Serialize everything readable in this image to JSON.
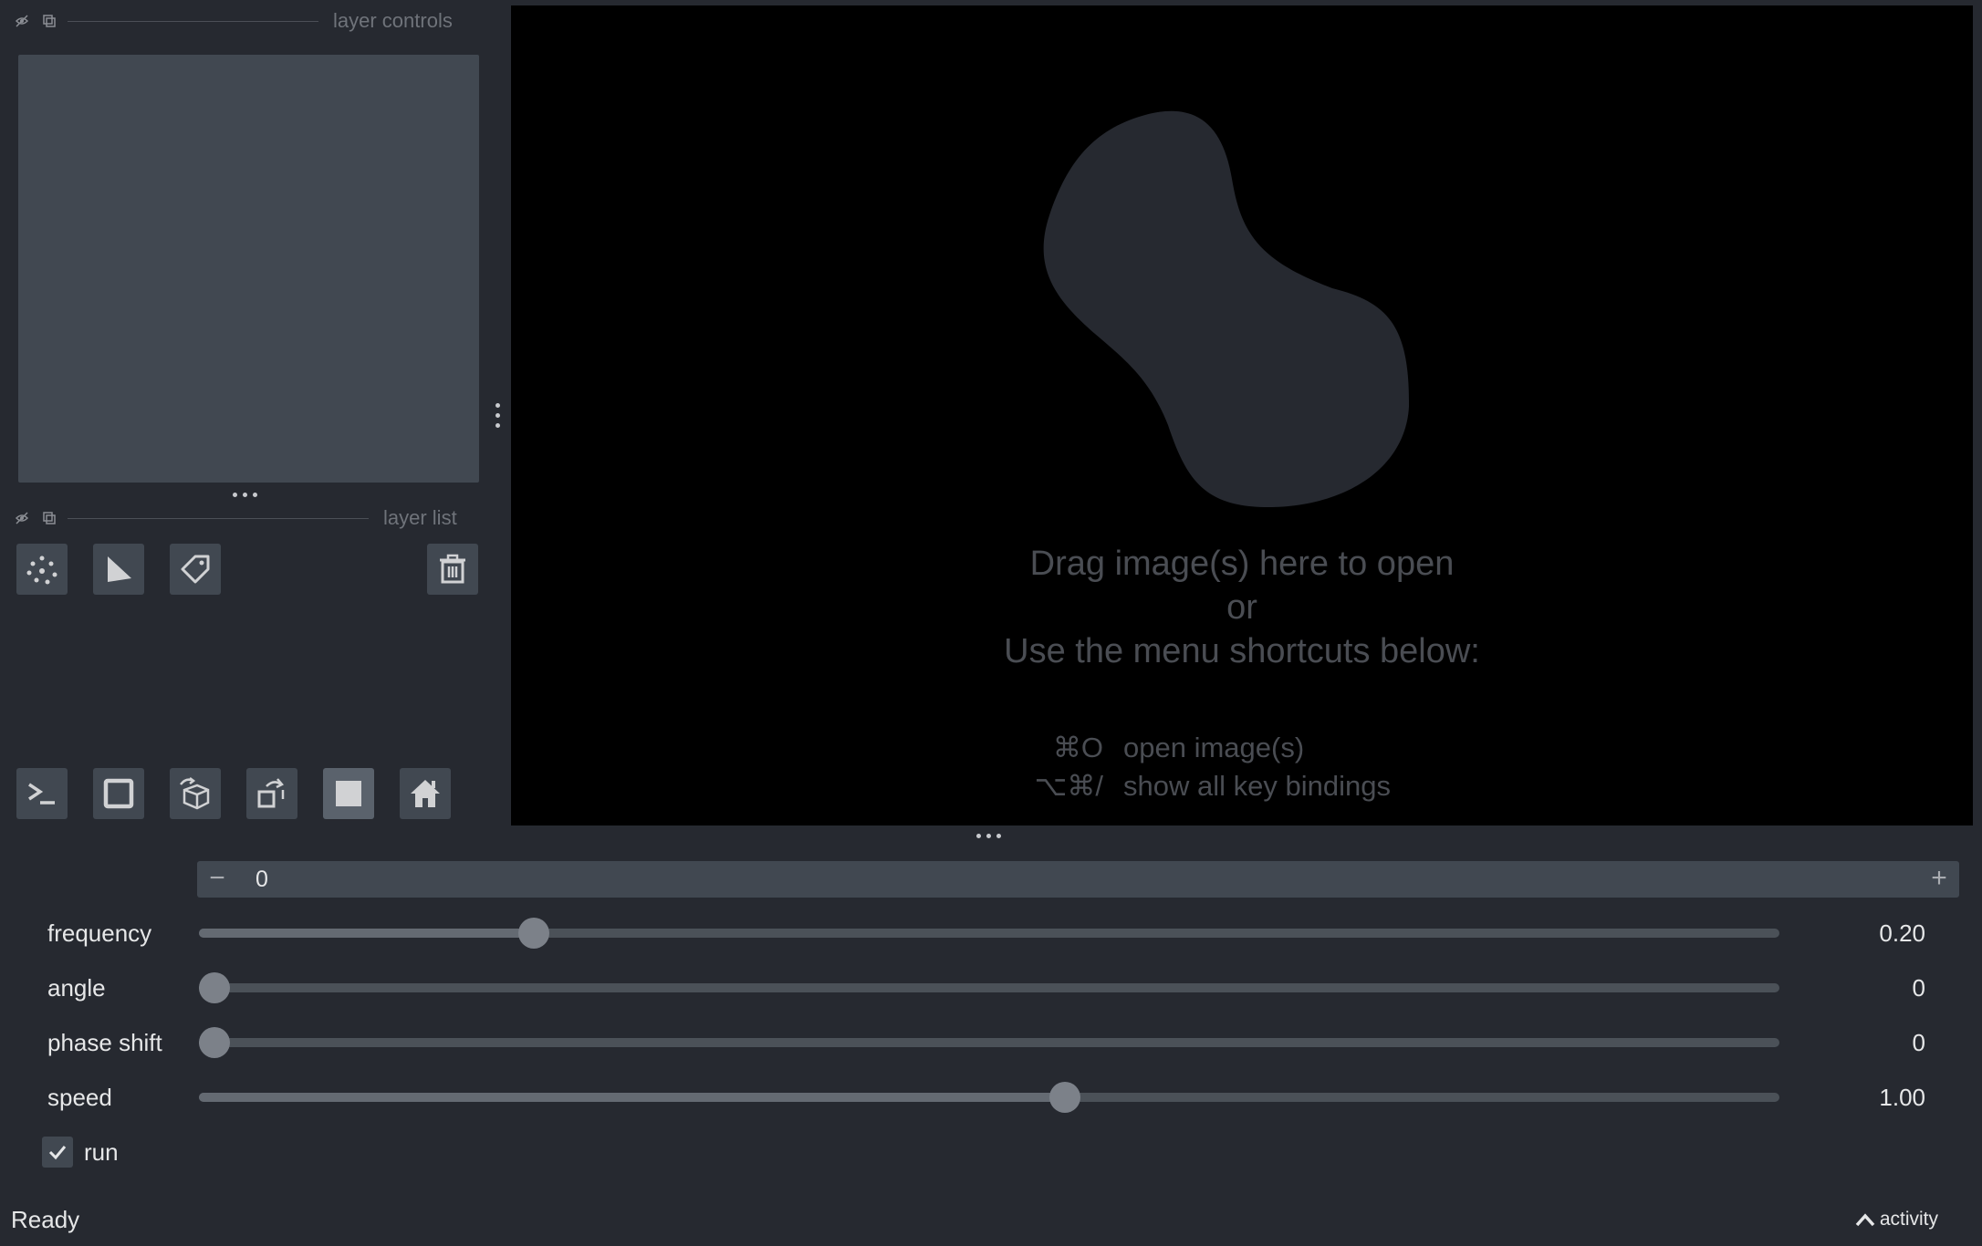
{
  "layer_controls": {
    "title": "layer controls"
  },
  "layer_list": {
    "title": "layer list"
  },
  "layer_tools": [
    {
      "name": "new-points-layer-button",
      "icon": "points-icon"
    },
    {
      "name": "new-shapes-layer-button",
      "icon": "shapes-icon"
    },
    {
      "name": "new-labels-layer-button",
      "icon": "labels-icon"
    }
  ],
  "viewer_buttons": [
    {
      "name": "console-button",
      "icon": "console-icon"
    },
    {
      "name": "ndisplay-button",
      "icon": "square-icon"
    },
    {
      "name": "roll-dims-button",
      "icon": "cube-roll-icon"
    },
    {
      "name": "transpose-dims-button",
      "icon": "transpose-icon"
    },
    {
      "name": "grid-view-button",
      "icon": "grid-square-icon"
    },
    {
      "name": "home-button",
      "icon": "home-icon"
    }
  ],
  "canvas": {
    "welcome_line1": "Drag image(s) here to open",
    "welcome_line2": "or",
    "welcome_line3": "Use the menu shortcuts below:",
    "shortcuts": [
      {
        "keys": "⌘O",
        "label": "open image(s)"
      },
      {
        "keys": "⌥⌘/",
        "label": "show all key bindings"
      }
    ]
  },
  "dims": {
    "value": "0",
    "minus": "−",
    "plus": "+"
  },
  "params": [
    {
      "label": "frequency",
      "value": "0.20",
      "fraction": 0.206
    },
    {
      "label": "angle",
      "value": "0",
      "fraction": 0.0
    },
    {
      "label": "phase shift",
      "value": "0",
      "fraction": 0.0
    },
    {
      "label": "speed",
      "value": "1.00",
      "fraction": 0.549
    }
  ],
  "run": {
    "label": "run",
    "checked": true
  },
  "status": {
    "text": "Ready"
  },
  "activity": {
    "label": "activity"
  },
  "colors": {
    "background": "#262930",
    "panel": "#414851",
    "canvas": "#000000",
    "logo": "#262930"
  }
}
